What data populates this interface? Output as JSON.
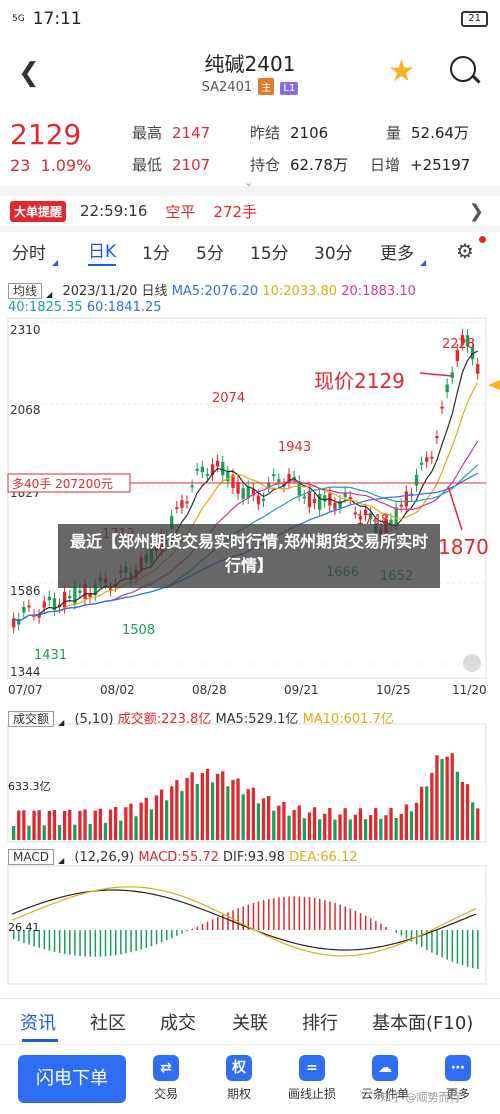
{
  "status_bar": {
    "signal": "5G",
    "time": "17:11",
    "battery": "21"
  },
  "header": {
    "title": "纯碱2401",
    "code": "SA2401",
    "tag1": "主",
    "tag2": "L1"
  },
  "quote": {
    "price": "2129",
    "change": "23",
    "change_pct": "1.09%",
    "high_label": "最高",
    "high": "2147",
    "low_label": "最低",
    "low": "2107",
    "prev_settle_label": "昨结",
    "prev_settle": "2106",
    "open_interest_label": "持仓",
    "open_interest": "62.78万",
    "volume_label": "量",
    "volume": "52.64万",
    "daily_inc_label": "日增",
    "daily_inc": "+25197"
  },
  "ticker": {
    "badge": "大单提醒",
    "time": "22:59:16",
    "type": "空平",
    "lots": "272手"
  },
  "periods": [
    "分时",
    "日K",
    "1分",
    "5分",
    "15分",
    "30分",
    "更多"
  ],
  "active_period": "日K",
  "ma_legend": {
    "mode": "均线",
    "date": "2023/11/20",
    "period": "日线",
    "ma5": "MA5:2076.20",
    "ma10": "10:2033.80",
    "ma20": "20:1883.10",
    "ma40": "40:1825.35",
    "ma60": "60:1841.25"
  },
  "price_axis": [
    "2310",
    "2068",
    "1827",
    "1586",
    "1344"
  ],
  "dates": [
    "07/07",
    "08/02",
    "08/28",
    "09/21",
    "10/25",
    "11/20"
  ],
  "annotations": {
    "current": "现价2129",
    "h2228": "2228",
    "h2074": "2074",
    "h1943": "1943",
    "h1748": "1748",
    "h1712": "1712",
    "l1870": "1870",
    "l1666": "1666",
    "l1652": "1652",
    "l1508": "1508",
    "l1431": "1431",
    "order_box": "多40手  207200元"
  },
  "volume_legend": {
    "label": "成交额",
    "params": "(5,10)",
    "amount": "成交额:223.8亿",
    "ma5": "MA5:529.1亿",
    "ma10": "MA10:601.7亿",
    "axis": "633.3亿"
  },
  "macd_legend": {
    "label": "MACD",
    "params": "(12,26,9)",
    "macd": "MACD:55.72",
    "dif": "DIF:93.98",
    "dea": "DEA:66.12",
    "axis": "26.41"
  },
  "overlay_text": "最近【郑州期货交易实时行情,郑州期货交易所实时行情】",
  "bottom_tabs": [
    "资讯",
    "社区",
    "成交",
    "关联",
    "排行",
    "基本面(F10)"
  ],
  "bottom_bar": {
    "flash": "闪电下单",
    "items": [
      "交易",
      "期权",
      "画线止损",
      "云条件单",
      "更多"
    ],
    "watermark": "知乎 @顺势而行"
  },
  "colors": {
    "up": "#e0282e",
    "down": "#18a058",
    "accent": "#1c5bd6",
    "ma5": "#2b2b2b",
    "ma10": "#e6a817",
    "ma20": "#d0379a",
    "ma40": "#1aa3a3",
    "ma60": "#2f6ef2"
  }
}
